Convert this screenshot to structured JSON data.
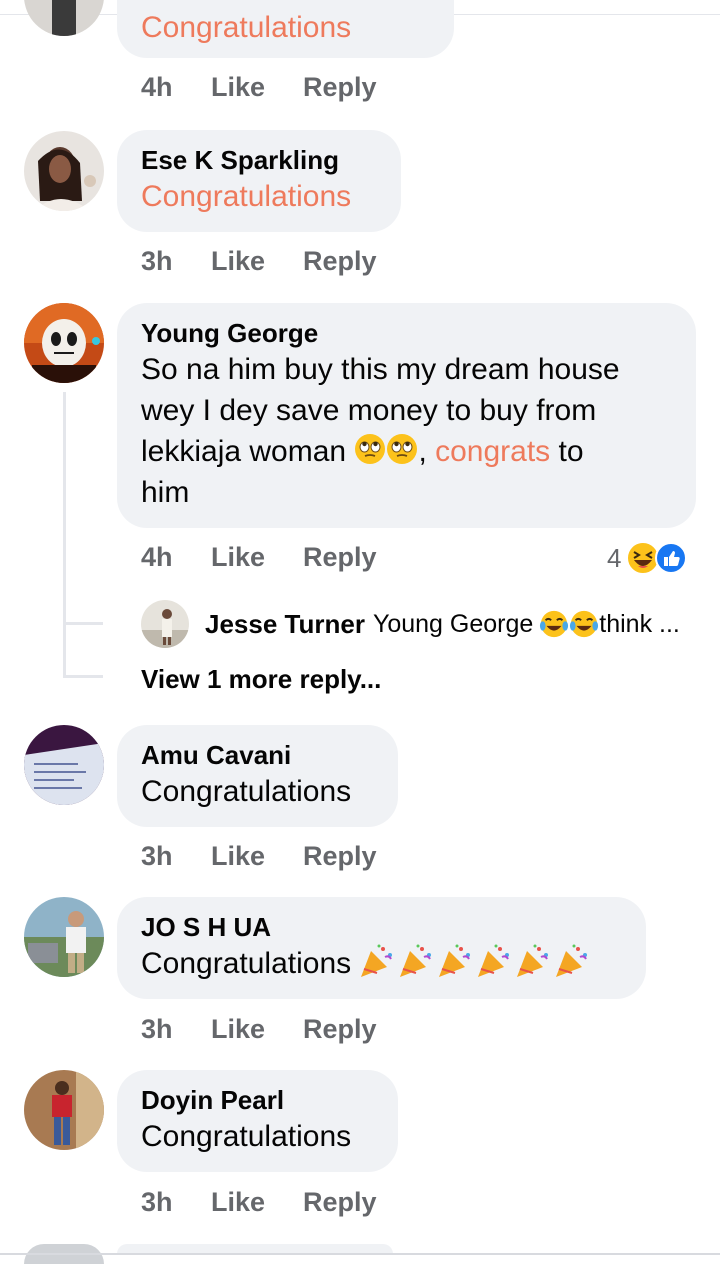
{
  "comments": [
    {
      "name": "",
      "text": "Congratulations",
      "time": "4h",
      "like": "Like",
      "reply": "Reply"
    },
    {
      "name": "Ese K Sparkling",
      "text": "Congratulations",
      "time": "3h",
      "like": "Like",
      "reply": "Reply"
    },
    {
      "name": "Young George",
      "text_lines": [
        "So na him buy this my dream house",
        "wey I dey save money to buy from",
        "lekkiaja woman",
        "him"
      ],
      "highlight": "congrats",
      "after_highlight": " to",
      "time": "4h",
      "like": "Like",
      "reply": "Reply",
      "reaction_count": "4",
      "reply_preview": {
        "name": "Jesse Turner",
        "text": "Young George",
        "trailing": "think ..."
      },
      "view_more": "View 1 more reply..."
    },
    {
      "name": "Amu Cavani",
      "text": "Congratulations",
      "time": "3h",
      "like": "Like",
      "reply": "Reply"
    },
    {
      "name": "JO S H UA",
      "text": "Congratulations",
      "time": "3h",
      "like": "Like",
      "reply": "Reply"
    },
    {
      "name": "Doyin Pearl",
      "text": "Congratulations",
      "time": "3h",
      "like": "Like",
      "reply": "Reply"
    }
  ],
  "colors": {
    "bubble": "#f0f2f5",
    "accent_orange": "#ee7a5c",
    "meta_gray": "#65676b",
    "like_blue": "#1877f2"
  }
}
